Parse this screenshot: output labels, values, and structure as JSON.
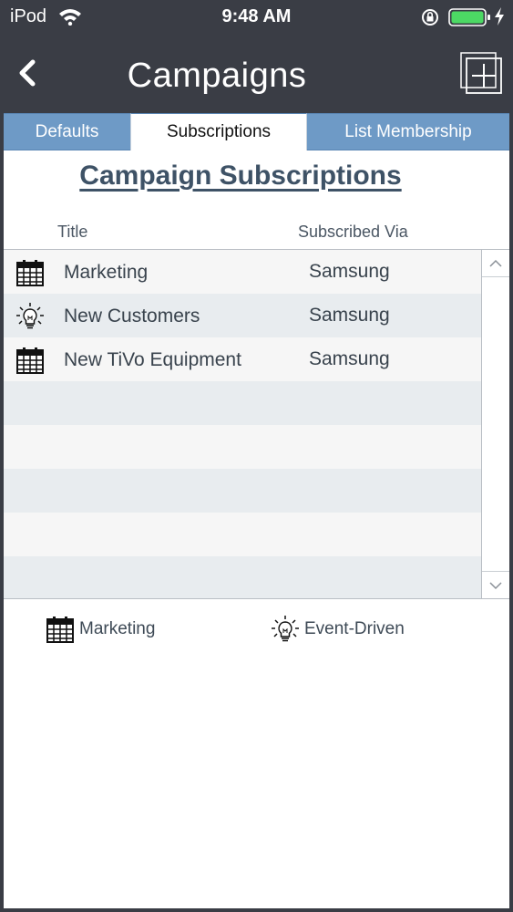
{
  "status_bar": {
    "carrier": "iPod",
    "time": "9:48 AM",
    "colors": {
      "battery": "#4cd964"
    }
  },
  "nav": {
    "title": "Campaigns"
  },
  "tabs": [
    {
      "label": "Defaults",
      "active": false
    },
    {
      "label": "Subscriptions",
      "active": true
    },
    {
      "label": "List Membership",
      "active": false
    }
  ],
  "section_title": "Campaign Subscriptions",
  "table": {
    "columns": {
      "title": "Title",
      "via": "Subscribed Via"
    },
    "rows": [
      {
        "icon": "calendar-icon",
        "title": "Marketing",
        "via": "Samsung"
      },
      {
        "icon": "lightbulb-icon",
        "title": "New Customers",
        "via": "Samsung"
      },
      {
        "icon": "calendar-icon",
        "title": "New TiVo Equipment",
        "via": "Samsung"
      }
    ]
  },
  "legend": {
    "marketing": {
      "icon": "calendar-icon",
      "label": "Marketing"
    },
    "event": {
      "icon": "lightbulb-icon",
      "label": "Event-Driven"
    }
  },
  "colors": {
    "nav_background": "#3a3d45",
    "tab_inactive": "#6e9ac6",
    "section_title": "#3e5266",
    "row_alt": "#e8ecef"
  }
}
